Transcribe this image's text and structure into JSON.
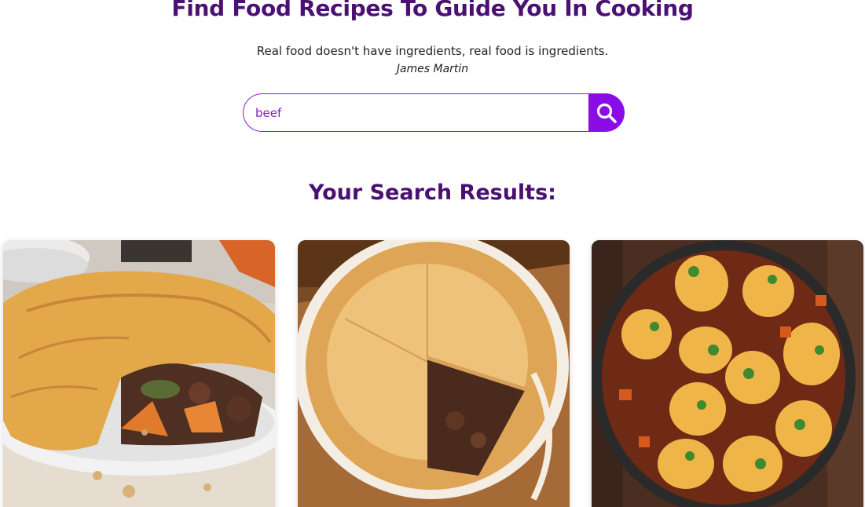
{
  "hero": {
    "title": "Find Food Recipes To Guide You In Cooking",
    "quote": "Real food doesn't have ingredients, real food is ingredients.",
    "author": "James Martin"
  },
  "search": {
    "value": "beef",
    "button_icon": "search-icon"
  },
  "results": {
    "title": "Your Search Results:",
    "cards": [
      {
        "image": "steak-pie-photo"
      },
      {
        "image": "beef-pie-slice-photo"
      },
      {
        "image": "beef-stew-dumplings-photo"
      }
    ]
  },
  "colors": {
    "heading": "#4a1072",
    "accent": "#8a0ce6",
    "input_border": "#8a1cc4"
  }
}
